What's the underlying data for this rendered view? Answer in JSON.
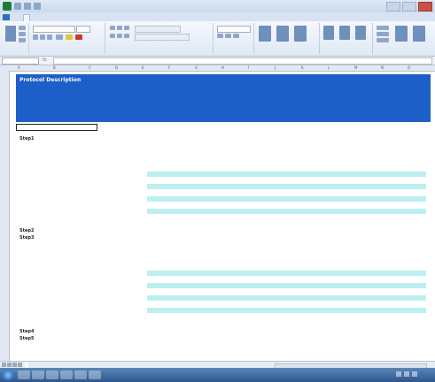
{
  "window": {
    "title": ""
  },
  "ribbon_tabs": [
    "",
    "",
    "",
    "",
    "",
    "",
    "",
    ""
  ],
  "sheet_header": {
    "title": "Protocol Description",
    "labels": [
      "",
      "",
      ""
    ],
    "values": [
      "",
      "",
      ""
    ]
  },
  "steps": [
    {
      "label": "Step1",
      "desc": ""
    },
    {
      "label": "Step2",
      "desc": ""
    },
    {
      "label": "Step3",
      "desc": ""
    },
    {
      "label": "Step4",
      "desc": ""
    },
    {
      "label": "Step5",
      "desc": ""
    }
  ],
  "sheet_tabs": [
    "",
    "",
    "",
    "",
    "",
    "",
    "",
    "",
    "",
    "",
    "",
    ""
  ],
  "clock": ""
}
